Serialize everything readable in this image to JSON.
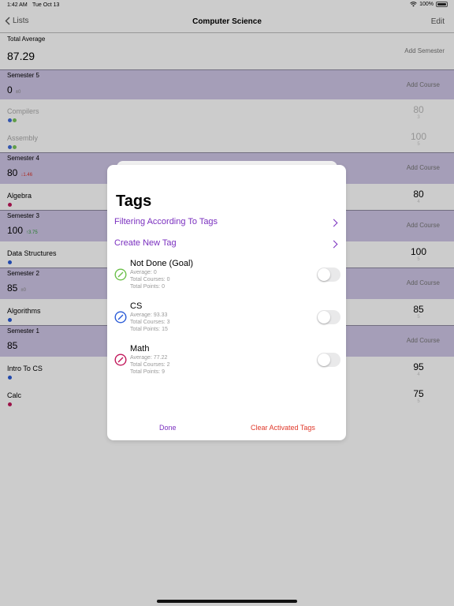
{
  "status": {
    "time": "1:42 AM",
    "date": "Tue Oct 13",
    "battery": "100%"
  },
  "nav": {
    "back_label": "Lists",
    "title": "Computer Science",
    "edit_label": "Edit"
  },
  "total": {
    "label": "Total Average",
    "value": "87.29",
    "add_semester_label": "Add Semester"
  },
  "colors": {
    "header_purple": "#cfc6e6",
    "accent_purple": "#7a2fbf",
    "danger_red": "#e0392b",
    "tag_green": "#6cc04a",
    "tag_blue": "#2a5bd7",
    "tag_red": "#c2185b"
  },
  "semesters": [
    {
      "title": "Semester 5",
      "value": "0",
      "delta": "±0",
      "delta_kind": "neutral",
      "add_label": "Add Course",
      "courses": [
        {
          "name": "Compilers",
          "score": "80",
          "sub": "3",
          "active": false,
          "dots": [
            "#2a5bd7",
            "#6cc04a"
          ]
        },
        {
          "name": "Assembly",
          "score": "100",
          "sub": "5",
          "active": false,
          "dots": [
            "#2a5bd7",
            "#6cc04a"
          ]
        }
      ]
    },
    {
      "title": "Semester 4",
      "value": "80",
      "delta": "↓1.46",
      "delta_kind": "down",
      "add_label": "Add Course",
      "courses": [
        {
          "name": "Algebra",
          "score": "80",
          "sub": "4",
          "active": true,
          "dots": [
            "#c2185b"
          ]
        }
      ]
    },
    {
      "title": "Semester 3",
      "value": "100",
      "delta": "↑3.75",
      "delta_kind": "up",
      "add_label": "Add Course",
      "courses": [
        {
          "name": "Data Structures",
          "score": "100",
          "sub": "5",
          "active": true,
          "dots": [
            "#2a5bd7"
          ]
        }
      ]
    },
    {
      "title": "Semester 2",
      "value": "85",
      "delta": "±0",
      "delta_kind": "neutral",
      "add_label": "Add Course",
      "courses": [
        {
          "name": "Algorithms",
          "score": "85",
          "sub": "5",
          "active": true,
          "dots": [
            "#2a5bd7"
          ]
        }
      ]
    },
    {
      "title": "Semester 1",
      "value": "85",
      "delta": "",
      "delta_kind": "neutral",
      "add_label": "Add Course",
      "courses": [
        {
          "name": "Intro To CS",
          "score": "95",
          "sub": "4",
          "active": true,
          "dots": [
            "#2a5bd7"
          ]
        },
        {
          "name": "Calc",
          "score": "75",
          "sub": "5",
          "active": true,
          "dots": [
            "#c2185b"
          ]
        }
      ]
    }
  ],
  "modal": {
    "title": "Tags",
    "filter_link": "Filtering According To Tags",
    "create_link": "Create New Tag",
    "tags": [
      {
        "name": "Not Done (Goal)",
        "average": "Average: 0",
        "courses": "Total Courses: 0",
        "points": "Total Points: 0",
        "color": "#6cc04a",
        "on": false
      },
      {
        "name": "CS",
        "average": "Average: 93.33",
        "courses": "Total Courses: 3",
        "points": "Total Points: 15",
        "color": "#2a5bd7",
        "on": false
      },
      {
        "name": "Math",
        "average": "Average: 77.22",
        "courses": "Total Courses: 2",
        "points": "Total Points: 9",
        "color": "#c2185b",
        "on": false
      }
    ],
    "done_label": "Done",
    "clear_label": "Clear Activated Tags"
  }
}
